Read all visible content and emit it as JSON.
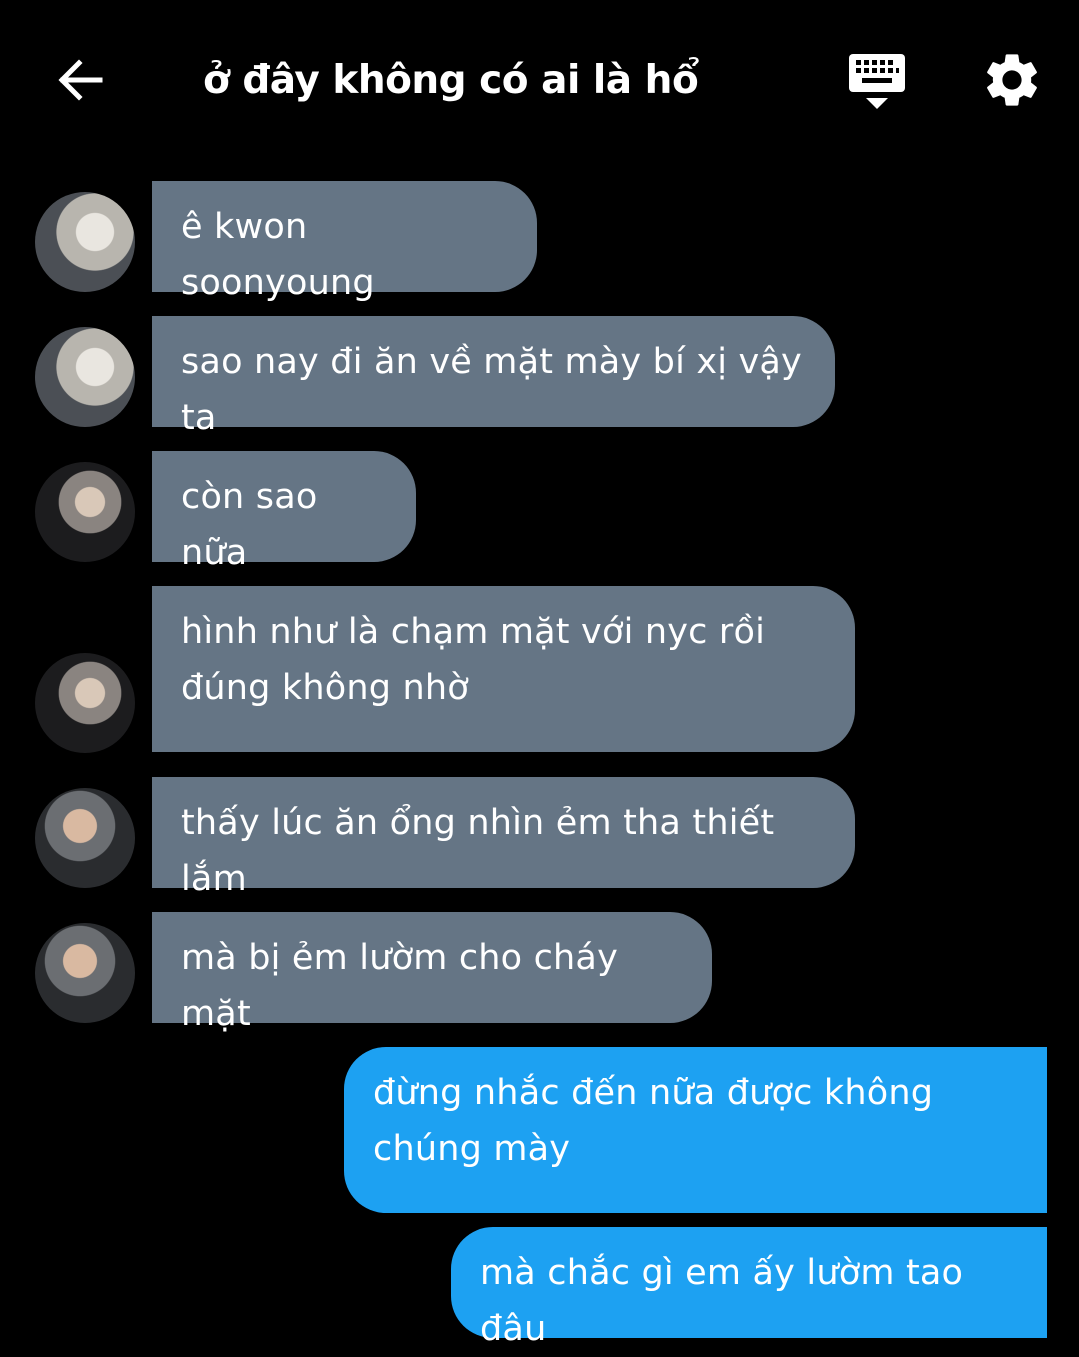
{
  "header": {
    "title": "ở đây không có ai là hổ",
    "back_icon": "arrow-left-icon",
    "keyboard_icon": "keyboard-hide-icon",
    "settings_icon": "gear-icon"
  },
  "messages": [
    {
      "side": "received",
      "text": "ê kwon soonyoung"
    },
    {
      "side": "received",
      "text": "sao nay đi ăn về mặt mày bí xị vậy ta"
    },
    {
      "side": "received",
      "text": "còn sao nữa"
    },
    {
      "side": "received",
      "text": "hình như là chạm mặt với nyc rồi\nđúng không nhờ"
    },
    {
      "side": "received",
      "text": "thấy lúc ăn ổng nhìn ẻm tha thiết lắm"
    },
    {
      "side": "received",
      "text": "mà bị ẻm lườm cho cháy mặt"
    },
    {
      "side": "sent",
      "text": "đừng nhắc đến nữa được không\nchúng mày"
    },
    {
      "side": "sent",
      "text": "mà chắc gì em ấy lườm tao đâu"
    }
  ],
  "colors": {
    "background": "#000000",
    "received_bubble": "#657585",
    "sent_bubble": "#1da1f2",
    "text": "#ffffff"
  }
}
